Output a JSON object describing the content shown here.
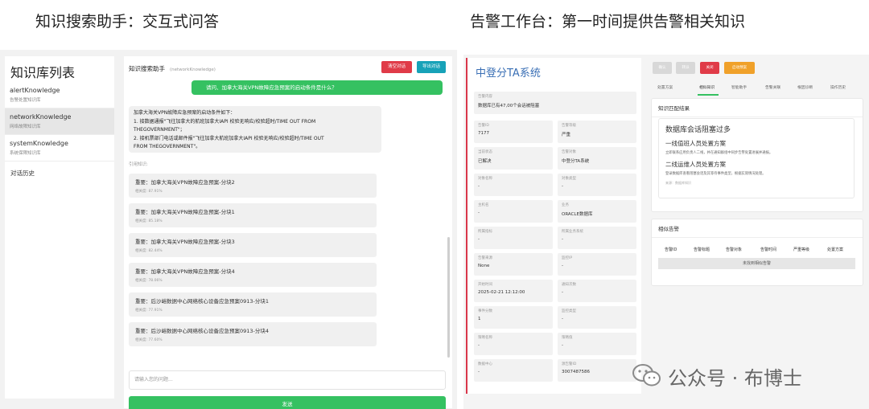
{
  "captions": {
    "left": "知识搜索助手：交互式问答",
    "right": "告警工作台：第一时间提供告警相关知识"
  },
  "knowledge": {
    "sidebar_title": "知识库列表",
    "items": [
      {
        "name": "alertKnowledge",
        "desc": "告警处置知识库"
      },
      {
        "name": "networkKnowledge",
        "desc": "网络故障知识库"
      },
      {
        "name": "systemKnowledge",
        "desc": "系统保障知识库"
      }
    ],
    "history": "对话历史"
  },
  "chat": {
    "title": "知识搜索助手",
    "subtitle": "(networkKnowledge)",
    "clear_button": "清空对话",
    "export_button": "导出对话",
    "user_message": "请问、加拿大海关VPN故障应急预案的启动条件是什么？",
    "answer_lines": [
      "加拿大海关VPN故障应急预案的启动条件如下：",
      "1. 接数据通报\"飞往加拿大的航班加拿大IAPI 校验无响应/校验超时/TIME OUT FROM",
      "THEGOVERNMENT\"；",
      "2. 接机票部门电话或邮件报\"飞往加拿大航班加拿大IAPI 校验无响应/校验超时/TIME OUT",
      "FROM THEGOVERNMENT\"。"
    ],
    "refs_label": "引用知识:",
    "refs": [
      {
        "title": "重要：加拿大海关VPN故障应急预案-分块2",
        "score": "相关度: 87.91%"
      },
      {
        "title": "重要：加拿大海关VPN故障应急预案-分块1",
        "score": "相关度: 85.18%"
      },
      {
        "title": "重要：加拿大海关VPN故障应急预案-分块3",
        "score": "相关度: 82.44%"
      },
      {
        "title": "重要：加拿大海关VPN故障应急预案-分块4",
        "score": "相关度: 78.06%"
      },
      {
        "title": "重要：后沙峪数据中心网络核心设备应急预案0913-分块1",
        "score": "相关度: 77.91%"
      },
      {
        "title": "重要：后沙峪数据中心网络核心设备应急预案0913-分块4",
        "score": "相关度: 77.60%"
      }
    ],
    "input_placeholder": "请输入您的问题...",
    "send_button": "发送"
  },
  "alert": {
    "title": "中登分TA系统",
    "fields": [
      {
        "k": "告警内容",
        "v": "数据库已有47,00个会话被阻塞"
      },
      {
        "k": "告警ID",
        "v": "7177"
      },
      {
        "k": "告警等级",
        "v": "严重"
      },
      {
        "k": "当前状态",
        "v": "已解决"
      },
      {
        "k": "告警对象",
        "v": "中登分TA系统"
      },
      {
        "k": "对象名称",
        "v": "-"
      },
      {
        "k": "对象类型",
        "v": "-"
      },
      {
        "k": "主机名",
        "v": "-"
      },
      {
        "k": "业务",
        "v": "ORACLE数据库"
      },
      {
        "k": "所属指标",
        "v": "-"
      },
      {
        "k": "所属业务系统",
        "v": "-"
      },
      {
        "k": "告警来源",
        "v": "None"
      },
      {
        "k": "监控IP",
        "v": "-"
      },
      {
        "k": "开始时间",
        "v": "2025-02-21 12:12:00"
      },
      {
        "k": "通知次数",
        "v": "-"
      },
      {
        "k": "事件分数",
        "v": "1"
      },
      {
        "k": "监控类型",
        "v": "-"
      },
      {
        "k": "策略名称",
        "v": "-"
      },
      {
        "k": "策略值",
        "v": "-"
      },
      {
        "k": "数据中心",
        "v": "-"
      },
      {
        "k": "源告警ID",
        "v": "3007487586"
      }
    ],
    "top_buttons": [
      {
        "label": "确认",
        "color": "#d8d8d8"
      },
      {
        "label": "转派",
        "color": "#d8d8d8"
      },
      {
        "label": "关闭",
        "color": "#e03b48"
      },
      {
        "label": "启动预案",
        "color": "#f0a12a"
      }
    ],
    "tabs": [
      "处置方案",
      "相似知识",
      "智能助手",
      "告警关联",
      "根因诊断",
      "操作历史"
    ],
    "active_tab": 1,
    "kb_match": {
      "title": "知识匹配结果",
      "big": "数据库会话阻塞过多",
      "h1": "一线值班人员处置方案",
      "p1": "立即联系应用负责人二线，并在通知群组中同步告警处置进展并通报。",
      "h2": "二线运维人员处置方案",
      "p2": "登录数据库查看阻塞会话及其等待事件类型，根据实际情况处理。",
      "meta": "来源：数据库知识"
    },
    "similar": {
      "title": "相似告警",
      "columns": [
        "告警ID",
        "告警标题",
        "告警对象",
        "告警时间",
        "严重等级",
        "处置方案"
      ],
      "empty": "未找到相似告警"
    }
  },
  "watermark": "公众号 · 布博士"
}
